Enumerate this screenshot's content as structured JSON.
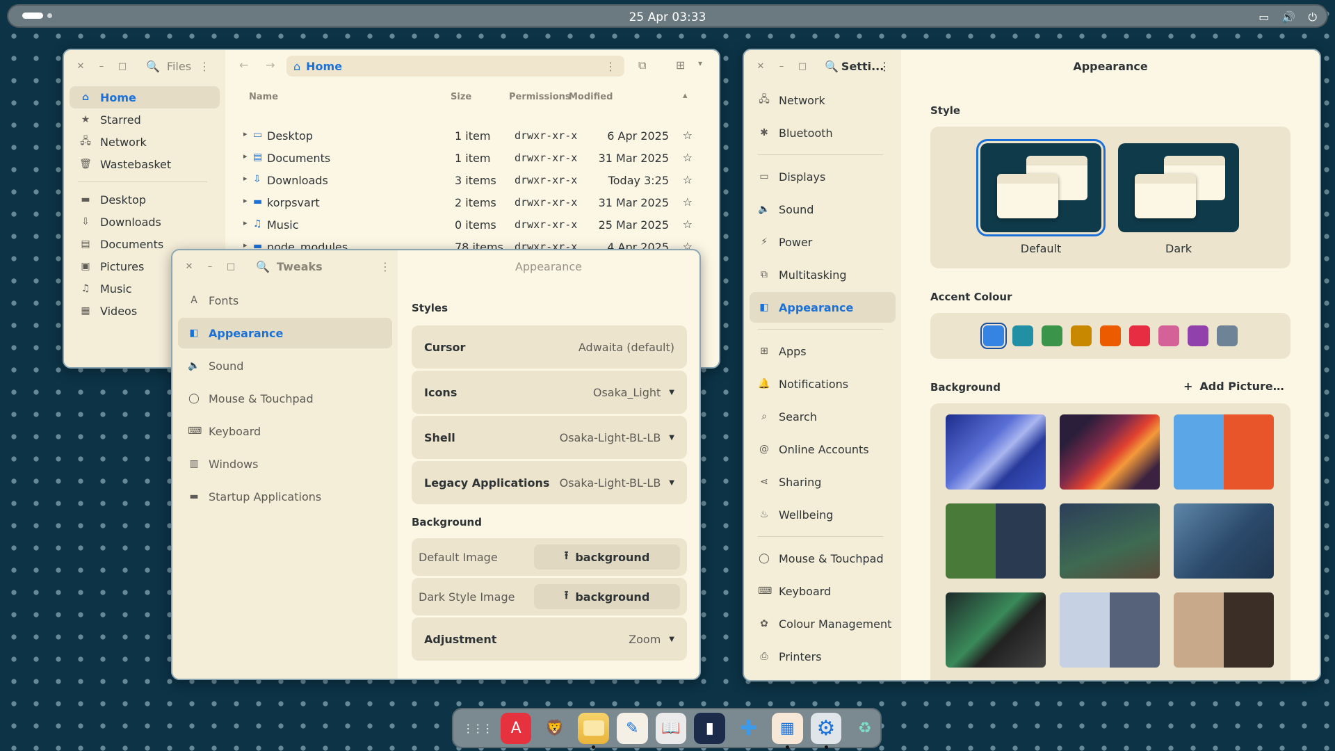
{
  "topbar": {
    "datetime": "25 Apr  03:33",
    "icons": [
      "screen-icon",
      "volume-icon",
      "power-icon"
    ]
  },
  "files": {
    "title": "Files",
    "path": "Home",
    "columns": [
      "Name",
      "Size",
      "Permissions",
      "Modified"
    ],
    "rows": [
      {
        "name": "Desktop",
        "size": "1 item",
        "perm": "drwxr-xr-x",
        "mod": "6 Apr 2025",
        "icon": "desktop-folder-icon"
      },
      {
        "name": "Documents",
        "size": "1 item",
        "perm": "drwxr-xr-x",
        "mod": "31 Mar 2025",
        "icon": "documents-folder-icon"
      },
      {
        "name": "Downloads",
        "size": "3 items",
        "perm": "drwxr-xr-x",
        "mod": "Today 3:25",
        "icon": "downloads-folder-icon"
      },
      {
        "name": "korpsvart",
        "size": "2 items",
        "perm": "drwxr-xr-x",
        "mod": "31 Mar 2025",
        "icon": "folder-icon"
      },
      {
        "name": "Music",
        "size": "0 items",
        "perm": "drwxr-xr-x",
        "mod": "25 Mar 2025",
        "icon": "music-folder-icon"
      },
      {
        "name": "node_modules",
        "size": "78 items",
        "perm": "drwxr-xr-x",
        "mod": "4 Apr 2025",
        "icon": "folder-icon"
      }
    ],
    "sidebar": [
      {
        "label": "Home",
        "icon": "home-icon",
        "selected": true
      },
      {
        "label": "Starred",
        "icon": "star-icon"
      },
      {
        "label": "Network",
        "icon": "network-icon"
      },
      {
        "label": "Wastebasket",
        "icon": "trash-icon"
      },
      {
        "label": "Desktop",
        "icon": "folder-icon"
      },
      {
        "label": "Downloads",
        "icon": "download-icon"
      },
      {
        "label": "Documents",
        "icon": "document-icon"
      },
      {
        "label": "Pictures",
        "icon": "picture-icon"
      },
      {
        "label": "Music",
        "icon": "music-icon"
      },
      {
        "label": "Videos",
        "icon": "video-icon"
      }
    ]
  },
  "tweaks": {
    "title": "Tweaks",
    "header": "Appearance",
    "nav": [
      {
        "label": "Fonts",
        "icon": "fonts-icon"
      },
      {
        "label": "Appearance",
        "icon": "appearance-icon",
        "selected": true
      },
      {
        "label": "Sound",
        "icon": "speaker-icon"
      },
      {
        "label": "Mouse & Touchpad",
        "icon": "mouse-icon"
      },
      {
        "label": "Keyboard",
        "icon": "keyboard-icon"
      },
      {
        "label": "Windows",
        "icon": "windows-icon"
      },
      {
        "label": "Startup Applications",
        "icon": "folder-icon"
      }
    ],
    "styles_heading": "Styles",
    "styles": [
      {
        "label": "Cursor",
        "value": "Adwaita (default)",
        "dropdown": false
      },
      {
        "label": "Icons",
        "value": "Osaka_Light",
        "dropdown": true
      },
      {
        "label": "Shell",
        "value": "Osaka-Light-BL-LB",
        "dropdown": true
      },
      {
        "label": "Legacy Applications",
        "value": "Osaka-Light-BL-LB",
        "dropdown": true
      }
    ],
    "background_heading": "Background",
    "bg_rows": [
      {
        "label": "Default Image",
        "button": "background"
      },
      {
        "label": "Dark Style Image",
        "button": "background"
      }
    ],
    "adjustment": {
      "label": "Adjustment",
      "value": "Zoom"
    }
  },
  "settings": {
    "title": "Setti...",
    "header": "Appearance",
    "nav_groups": [
      [
        {
          "label": "Network",
          "icon": "network-icon"
        },
        {
          "label": "Bluetooth",
          "icon": "bluetooth-icon"
        }
      ],
      [
        {
          "label": "Displays",
          "icon": "display-icon"
        },
        {
          "label": "Sound",
          "icon": "speaker-icon"
        },
        {
          "label": "Power",
          "icon": "power-icon"
        },
        {
          "label": "Multitasking",
          "icon": "multitasking-icon"
        },
        {
          "label": "Appearance",
          "icon": "appearance-icon",
          "selected": true
        }
      ],
      [
        {
          "label": "Apps",
          "icon": "apps-icon"
        },
        {
          "label": "Notifications",
          "icon": "bell-icon"
        },
        {
          "label": "Search",
          "icon": "search-icon"
        },
        {
          "label": "Online Accounts",
          "icon": "at-icon"
        },
        {
          "label": "Sharing",
          "icon": "share-icon"
        },
        {
          "label": "Wellbeing",
          "icon": "wellbeing-icon"
        }
      ],
      [
        {
          "label": "Mouse & Touchpad",
          "icon": "mouse-icon"
        },
        {
          "label": "Keyboard",
          "icon": "keyboard-icon"
        },
        {
          "label": "Colour Management",
          "icon": "colour-icon"
        },
        {
          "label": "Printers",
          "icon": "printer-icon"
        }
      ]
    ],
    "style_heading": "Style",
    "styles": [
      {
        "label": "Default",
        "selected": true
      },
      {
        "label": "Dark"
      }
    ],
    "accent_heading": "Accent Colour",
    "accents": [
      "#3584e4",
      "#2190a4",
      "#3a944a",
      "#c88800",
      "#ed5b00",
      "#e62d42",
      "#d56199",
      "#9141ac",
      "#6f8396"
    ],
    "background_heading": "Background",
    "add_picture": "Add Picture…"
  },
  "dock": {
    "apps": [
      {
        "name": "app-grid-icon",
        "bg": "transparent",
        "glyph": "⋮⋮⋮",
        "run": false
      },
      {
        "name": "app-center-icon",
        "bg": "#e5323e",
        "glyph": "A",
        "run": false
      },
      {
        "name": "brave-browser-icon",
        "bg": "transparent",
        "glyph": "🦁",
        "run": false
      },
      {
        "name": "files-app-icon",
        "bg": "#f2c94c",
        "glyph": "",
        "run": true
      },
      {
        "name": "text-editor-icon",
        "bg": "#f5f0e6",
        "glyph": "✎",
        "run": false
      },
      {
        "name": "reader-app-icon",
        "bg": "#eaeaea",
        "glyph": "📖",
        "run": false
      },
      {
        "name": "terminal-app-icon",
        "bg": "#1c2b4a",
        "glyph": "▮",
        "run": false
      },
      {
        "name": "extensions-app-icon",
        "bg": "transparent",
        "glyph": "✚",
        "run": false
      },
      {
        "name": "tweaks-app-icon",
        "bg": "#f6e7d6",
        "glyph": "▦",
        "run": true
      },
      {
        "name": "settings-app-icon",
        "bg": "#dfe5e8",
        "glyph": "⚙",
        "run": true
      },
      {
        "name": "trash-app-icon",
        "bg": "transparent",
        "glyph": "♻",
        "run": false
      }
    ]
  }
}
